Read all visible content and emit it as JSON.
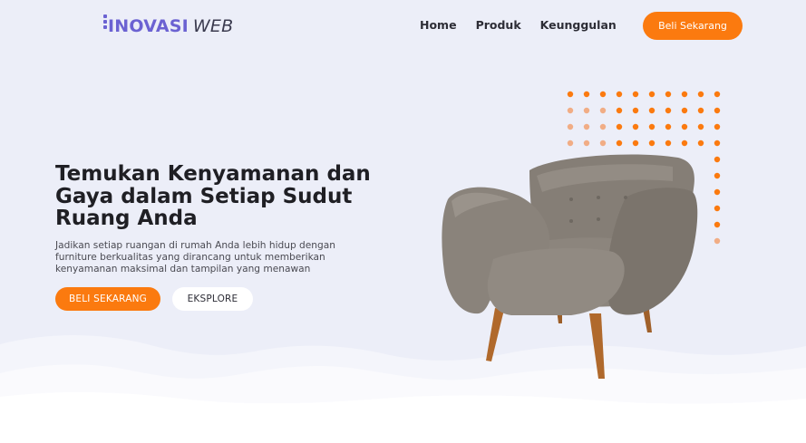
{
  "header": {
    "logo_bold": "INOVASI",
    "logo_light": "WEB",
    "nav": [
      {
        "label": "Home"
      },
      {
        "label": "Produk"
      },
      {
        "label": "Keunggulan"
      }
    ],
    "cta": "Beli Sekarang"
  },
  "hero": {
    "title": "Temukan Kenyamanan dan Gaya dalam Setiap Sudut Ruang Anda",
    "subtitle": "Jadikan setiap ruangan di rumah Anda lebih hidup dengan furniture berkualitas yang dirancang untuk memberikan kenyamanan maksimal dan tampilan yang menawan",
    "primary_button": "BELI SEKARANG",
    "secondary_button": "EKSPLORE"
  },
  "colors": {
    "accent": "#fb7a0f",
    "brand": "#6b62d2",
    "background": "#eceef8",
    "dot_faded": "#f1ad85"
  },
  "icons": {
    "logo_mark": "stacked-squares-icon",
    "decoration": "dot-grid-pattern",
    "product_image": "armchair-image"
  }
}
